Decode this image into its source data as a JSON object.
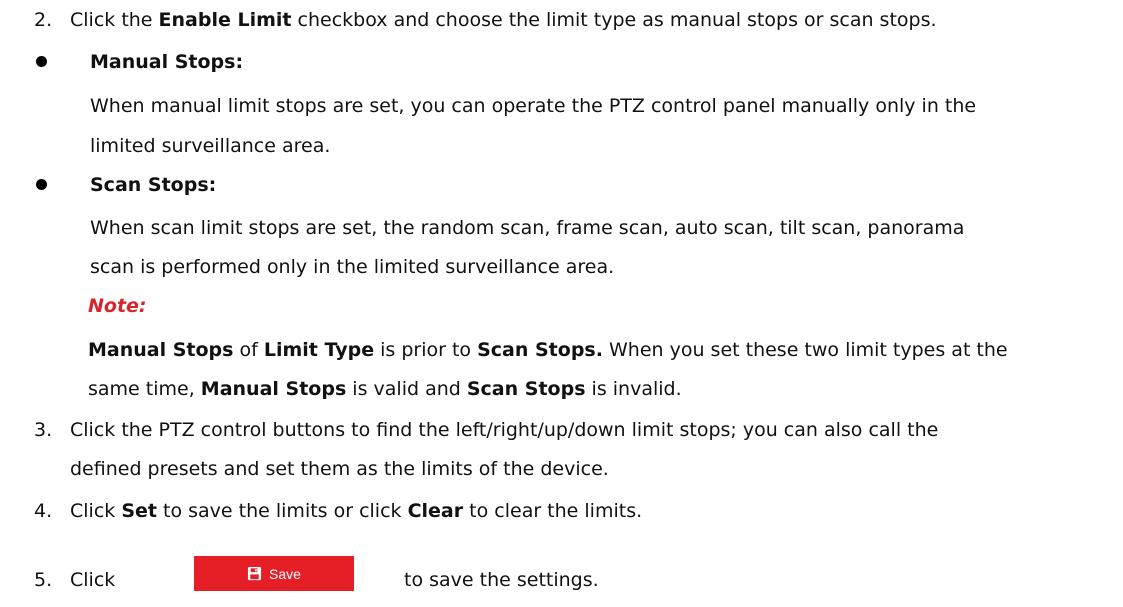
{
  "steps": {
    "s2": {
      "num": "2.",
      "t1": "Click the ",
      "b1": "Enable Limit",
      "t2": " checkbox and choose the limit type as manual stops or scan stops."
    },
    "manual": {
      "heading": "Manual Stops:",
      "line1": "When manual limit stops are set, you can operate the PTZ control panel manually only in the",
      "line2": "limited surveillance area."
    },
    "scan": {
      "heading": "Scan Stops:",
      "line1": "When scan limit stops are set, the random scan, frame scan, auto scan, tilt scan, panorama",
      "line2": "scan is performed only in the limited surveillance area."
    },
    "note": {
      "label": "Note:",
      "l1_b1": "Manual Stops",
      "l1_t1": " of ",
      "l1_b2": "Limit Type",
      "l1_t2": " is prior to ",
      "l1_b3": "Scan Stops.",
      "l1_t3": " When you set these two limit types at the",
      "l2_t1": "same time, ",
      "l2_b1": "Manual Stops",
      "l2_t2": " is valid and ",
      "l2_b2": "Scan Stops",
      "l2_t3": " is invalid."
    },
    "s3": {
      "num": "3.",
      "line1": "Click the PTZ control buttons to find the left/right/up/down limit stops; you can also call the",
      "line2": "defined presets and set them as the limits of the device."
    },
    "s4": {
      "num": "4.",
      "t1": "Click ",
      "b1": "Set",
      "t2": " to save the limits or click ",
      "b2": "Clear",
      "t3": " to clear the limits."
    },
    "s5": {
      "num": "5.",
      "t1": "Click",
      "t2": "to save the settings."
    }
  },
  "save_button": {
    "label": "Save",
    "icon": "save-icon",
    "color": "#e61e26"
  },
  "colors": {
    "note": "#d7262b",
    "text": "#111111"
  }
}
